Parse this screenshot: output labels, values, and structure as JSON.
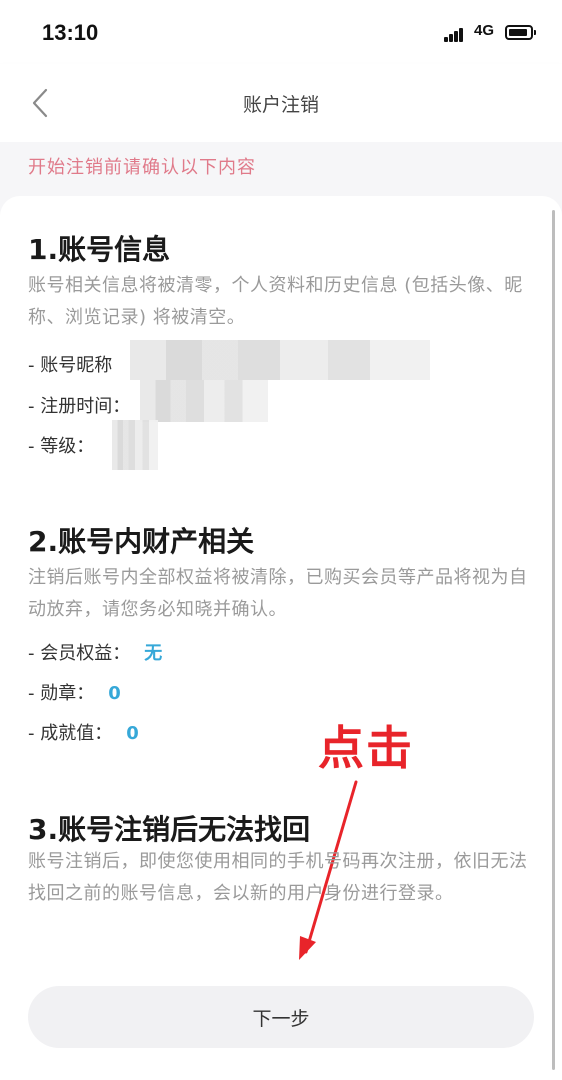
{
  "status_bar": {
    "time": "13:10",
    "network": "4G"
  },
  "nav": {
    "title": "账户注销"
  },
  "notice": "开始注销前请确认以下内容",
  "sections": [
    {
      "title": "1.账号信息",
      "desc": "账号相关信息将被清零，个人资料和历史信息 (包括头像、昵称、浏览记录) 将被清空。",
      "rows": [
        {
          "label": "- 账号昵称",
          "value": ""
        },
        {
          "label": "- 注册时间：",
          "value": ""
        },
        {
          "label": "- 等级：",
          "value": ""
        }
      ]
    },
    {
      "title": "2.账号内财产相关",
      "desc": "注销后账号内全部权益将被清除，已购买会员等产品将视为自动放弃，请您务必知晓并确认。",
      "rows": [
        {
          "label": "- 会员权益：",
          "value": "无"
        },
        {
          "label": "- 勋章：",
          "value": "0"
        },
        {
          "label": "- 成就值：",
          "value": "0"
        }
      ]
    },
    {
      "title": "3.账号注销后无法找回",
      "desc": "账号注销后，即使您使用相同的手机号码再次注册，依旧无法找回之前的账号信息，会以新的用户身份进行登录。"
    }
  ],
  "annotation": "点击",
  "next_button": "下一步",
  "colors": {
    "notice": "#e07a8a",
    "value": "#36a8d8",
    "annotation": "#e8242a"
  }
}
